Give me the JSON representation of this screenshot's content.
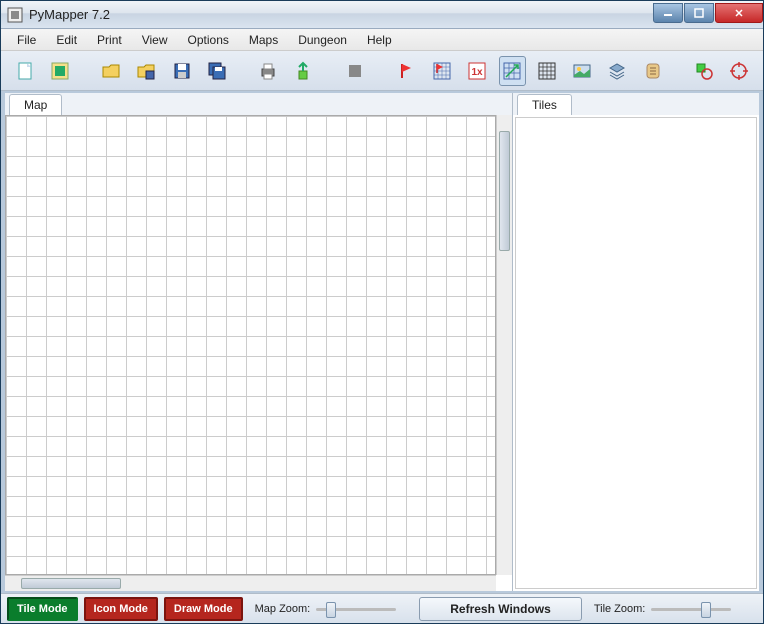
{
  "title": "PyMapper 7.2",
  "menu": [
    "File",
    "Edit",
    "Print",
    "View",
    "Options",
    "Maps",
    "Dungeon",
    "Help"
  ],
  "tabs": {
    "map": "Map",
    "tiles": "Tiles"
  },
  "modes": {
    "tile": "Tile Mode",
    "icon": "Icon Mode",
    "draw": "Draw Mode"
  },
  "labels": {
    "map_zoom": "Map Zoom:",
    "tile_zoom": "Tile Zoom:",
    "refresh": "Refresh Windows"
  },
  "toolbar_icons": [
    "new",
    "frame",
    "open",
    "save-as",
    "save",
    "save-all",
    "print",
    "export",
    "block",
    "flag",
    "flag-grid",
    "1x",
    "snap-grid",
    "grid",
    "image",
    "layers",
    "scroll",
    "shape",
    "target"
  ]
}
